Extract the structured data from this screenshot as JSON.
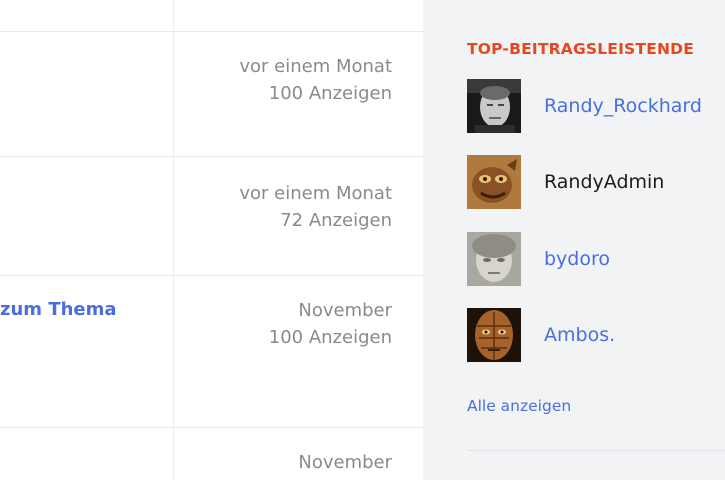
{
  "topics": [
    {
      "time": "vor einem Monat",
      "views": "100 Anzeigen"
    },
    {
      "time": "vor einem Monat",
      "views": "72 Anzeigen"
    },
    {
      "title_fragment": "zum Thema",
      "time": "November",
      "views": "100 Anzeigen"
    },
    {
      "time": "November"
    }
  ],
  "sidebar": {
    "heading": "TOP-BEITRAGSLEISTENDE",
    "users": [
      {
        "name": "Randy_Rockhard"
      },
      {
        "name": "RandyAdmin"
      },
      {
        "name": "bydoro"
      },
      {
        "name": "Ambos."
      }
    ],
    "show_all": "Alle anzeigen"
  },
  "colors": {
    "accent_heading": "#e8471d",
    "link": "#4a6fdc",
    "sidebar_bg": "#f2f3f5"
  }
}
